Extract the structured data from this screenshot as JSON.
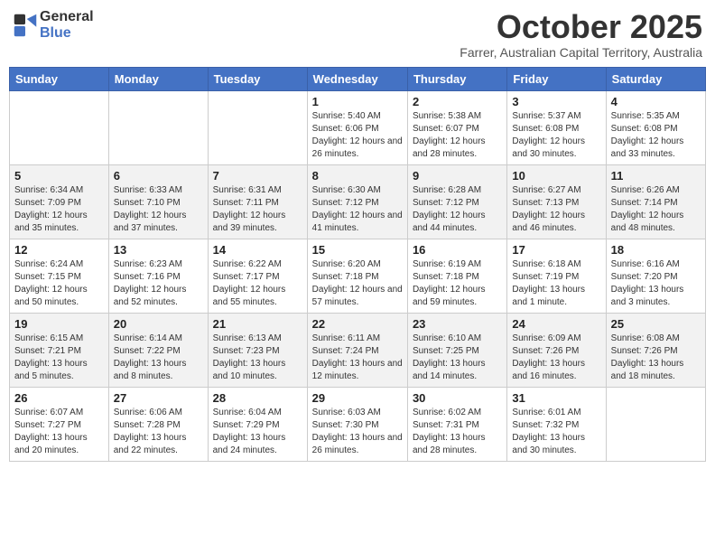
{
  "header": {
    "logo_line1": "General",
    "logo_line2": "Blue",
    "month": "October 2025",
    "location": "Farrer, Australian Capital Territory, Australia"
  },
  "weekdays": [
    "Sunday",
    "Monday",
    "Tuesday",
    "Wednesday",
    "Thursday",
    "Friday",
    "Saturday"
  ],
  "weeks": [
    [
      {
        "day": "",
        "content": ""
      },
      {
        "day": "",
        "content": ""
      },
      {
        "day": "",
        "content": ""
      },
      {
        "day": "1",
        "content": "Sunrise: 5:40 AM\nSunset: 6:06 PM\nDaylight: 12 hours\nand 26 minutes."
      },
      {
        "day": "2",
        "content": "Sunrise: 5:38 AM\nSunset: 6:07 PM\nDaylight: 12 hours\nand 28 minutes."
      },
      {
        "day": "3",
        "content": "Sunrise: 5:37 AM\nSunset: 6:08 PM\nDaylight: 12 hours\nand 30 minutes."
      },
      {
        "day": "4",
        "content": "Sunrise: 5:35 AM\nSunset: 6:08 PM\nDaylight: 12 hours\nand 33 minutes."
      }
    ],
    [
      {
        "day": "5",
        "content": "Sunrise: 6:34 AM\nSunset: 7:09 PM\nDaylight: 12 hours\nand 35 minutes."
      },
      {
        "day": "6",
        "content": "Sunrise: 6:33 AM\nSunset: 7:10 PM\nDaylight: 12 hours\nand 37 minutes."
      },
      {
        "day": "7",
        "content": "Sunrise: 6:31 AM\nSunset: 7:11 PM\nDaylight: 12 hours\nand 39 minutes."
      },
      {
        "day": "8",
        "content": "Sunrise: 6:30 AM\nSunset: 7:12 PM\nDaylight: 12 hours\nand 41 minutes."
      },
      {
        "day": "9",
        "content": "Sunrise: 6:28 AM\nSunset: 7:12 PM\nDaylight: 12 hours\nand 44 minutes."
      },
      {
        "day": "10",
        "content": "Sunrise: 6:27 AM\nSunset: 7:13 PM\nDaylight: 12 hours\nand 46 minutes."
      },
      {
        "day": "11",
        "content": "Sunrise: 6:26 AM\nSunset: 7:14 PM\nDaylight: 12 hours\nand 48 minutes."
      }
    ],
    [
      {
        "day": "12",
        "content": "Sunrise: 6:24 AM\nSunset: 7:15 PM\nDaylight: 12 hours\nand 50 minutes."
      },
      {
        "day": "13",
        "content": "Sunrise: 6:23 AM\nSunset: 7:16 PM\nDaylight: 12 hours\nand 52 minutes."
      },
      {
        "day": "14",
        "content": "Sunrise: 6:22 AM\nSunset: 7:17 PM\nDaylight: 12 hours\nand 55 minutes."
      },
      {
        "day": "15",
        "content": "Sunrise: 6:20 AM\nSunset: 7:18 PM\nDaylight: 12 hours\nand 57 minutes."
      },
      {
        "day": "16",
        "content": "Sunrise: 6:19 AM\nSunset: 7:18 PM\nDaylight: 12 hours\nand 59 minutes."
      },
      {
        "day": "17",
        "content": "Sunrise: 6:18 AM\nSunset: 7:19 PM\nDaylight: 13 hours\nand 1 minute."
      },
      {
        "day": "18",
        "content": "Sunrise: 6:16 AM\nSunset: 7:20 PM\nDaylight: 13 hours\nand 3 minutes."
      }
    ],
    [
      {
        "day": "19",
        "content": "Sunrise: 6:15 AM\nSunset: 7:21 PM\nDaylight: 13 hours\nand 5 minutes."
      },
      {
        "day": "20",
        "content": "Sunrise: 6:14 AM\nSunset: 7:22 PM\nDaylight: 13 hours\nand 8 minutes."
      },
      {
        "day": "21",
        "content": "Sunrise: 6:13 AM\nSunset: 7:23 PM\nDaylight: 13 hours\nand 10 minutes."
      },
      {
        "day": "22",
        "content": "Sunrise: 6:11 AM\nSunset: 7:24 PM\nDaylight: 13 hours\nand 12 minutes."
      },
      {
        "day": "23",
        "content": "Sunrise: 6:10 AM\nSunset: 7:25 PM\nDaylight: 13 hours\nand 14 minutes."
      },
      {
        "day": "24",
        "content": "Sunrise: 6:09 AM\nSunset: 7:26 PM\nDaylight: 13 hours\nand 16 minutes."
      },
      {
        "day": "25",
        "content": "Sunrise: 6:08 AM\nSunset: 7:26 PM\nDaylight: 13 hours\nand 18 minutes."
      }
    ],
    [
      {
        "day": "26",
        "content": "Sunrise: 6:07 AM\nSunset: 7:27 PM\nDaylight: 13 hours\nand 20 minutes."
      },
      {
        "day": "27",
        "content": "Sunrise: 6:06 AM\nSunset: 7:28 PM\nDaylight: 13 hours\nand 22 minutes."
      },
      {
        "day": "28",
        "content": "Sunrise: 6:04 AM\nSunset: 7:29 PM\nDaylight: 13 hours\nand 24 minutes."
      },
      {
        "day": "29",
        "content": "Sunrise: 6:03 AM\nSunset: 7:30 PM\nDaylight: 13 hours\nand 26 minutes."
      },
      {
        "day": "30",
        "content": "Sunrise: 6:02 AM\nSunset: 7:31 PM\nDaylight: 13 hours\nand 28 minutes."
      },
      {
        "day": "31",
        "content": "Sunrise: 6:01 AM\nSunset: 7:32 PM\nDaylight: 13 hours\nand 30 minutes."
      },
      {
        "day": "",
        "content": ""
      }
    ]
  ]
}
